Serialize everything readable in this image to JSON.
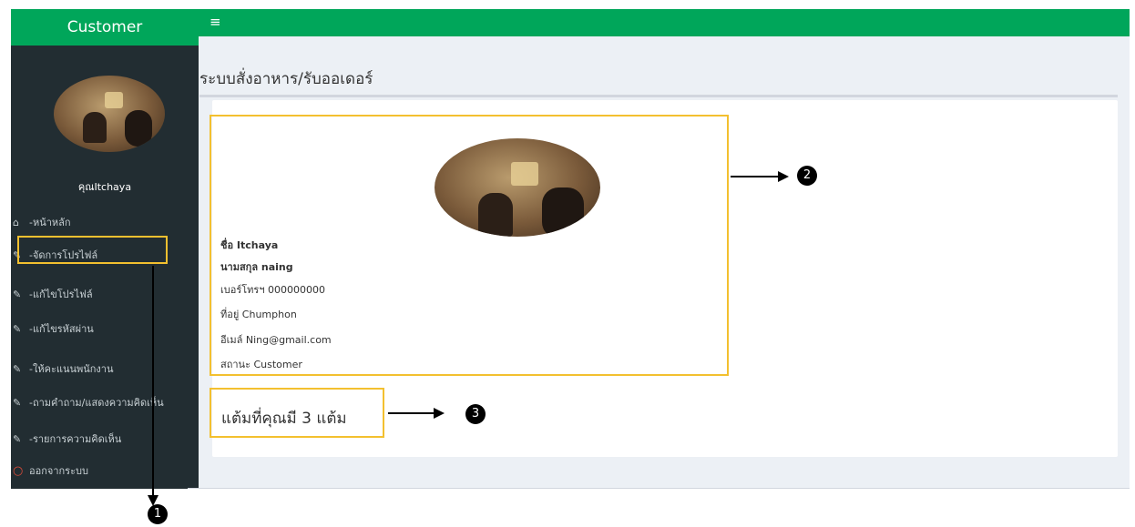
{
  "app": {
    "brand": "Customer",
    "menu_toggle_icon": "hamburger-icon"
  },
  "sidebar": {
    "user_name": "คุณItchaya",
    "items": [
      {
        "label": "-หน้าหลัก",
        "icon": "home-icon"
      },
      {
        "label": "-จัดการโปรไฟล์",
        "icon": "edit-icon"
      },
      {
        "label": "-แก้ไขโปรไฟล์",
        "icon": "edit-icon"
      },
      {
        "label": "-แก้ไขรหัสผ่าน",
        "icon": "edit-icon"
      },
      {
        "label": "-ให้คะแนนพนักงาน",
        "icon": "edit-icon"
      },
      {
        "label": "-ถามคำถาม/แสดงความคิดเห็น",
        "icon": "edit-icon"
      },
      {
        "label": "-รายการความคิดเห็น",
        "icon": "edit-icon"
      },
      {
        "label": "ออกจากระบบ",
        "icon": "power-icon"
      }
    ]
  },
  "page": {
    "title": "ระบบสั่งอาหาร/รับออเดอร์"
  },
  "profile": {
    "first_name": "ชื่อ Itchaya",
    "last_name": "นามสกุล naing",
    "phone": "เบอร์โทรฯ 000000000",
    "address": "ที่อยู่ Chumphon",
    "email": "อีเมล์ Ning@gmail.com",
    "status": "สถานะ Customer"
  },
  "points_text": "แต้มที่คุณมี 3 แต้ม",
  "callouts": {
    "one": "1",
    "two": "2",
    "three": "3"
  },
  "colors": {
    "brand_green": "#00a65a",
    "sidebar_bg": "#222d32",
    "highlight": "#f3c02f",
    "logout_red": "#dd4b39"
  }
}
